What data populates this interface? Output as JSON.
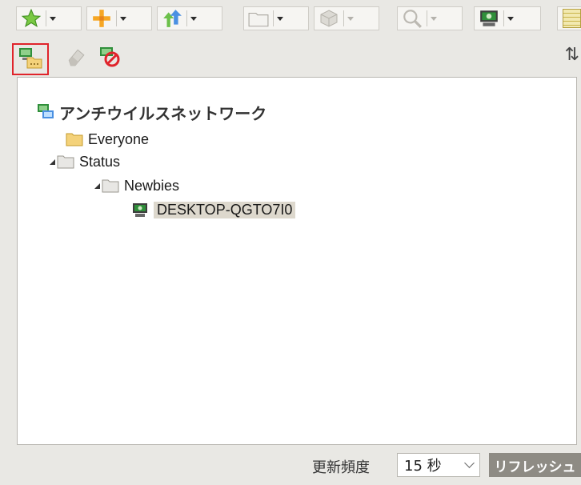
{
  "toolbar": {
    "items": [
      {
        "icon": "star-icon",
        "color": "#4caf2f"
      },
      {
        "icon": "plus-icon",
        "color": "#f39c12"
      },
      {
        "icon": "move-arrows-icon",
        "color": "#3aa"
      },
      {
        "icon": "folder-icon",
        "color": "#bdbab2"
      },
      {
        "icon": "package-icon",
        "color": "#bdbab2"
      },
      {
        "icon": "search-icon",
        "color": "#bdbab2"
      },
      {
        "icon": "computer-icon",
        "color": "#2e8b2e"
      }
    ]
  },
  "subbar": {
    "buttons": [
      {
        "icon": "group-folder-icon",
        "highlighted": true
      },
      {
        "icon": "eraser-icon",
        "highlighted": false
      },
      {
        "icon": "blocked-computer-icon",
        "highlighted": false
      }
    ]
  },
  "tree": {
    "root": "アンチウイルスネットワーク",
    "everyone": "Everyone",
    "status": "Status",
    "newbies": "Newbies",
    "desktop": "DESKTOP-QGTO7I0"
  },
  "footer": {
    "refresh_label": "更新頻度",
    "frequency_value": "15 秒",
    "refresh_button": "リフレッシュ"
  },
  "colors": {
    "highlight_border": "#e0242b",
    "selected_bg": "#ddd8cd"
  }
}
